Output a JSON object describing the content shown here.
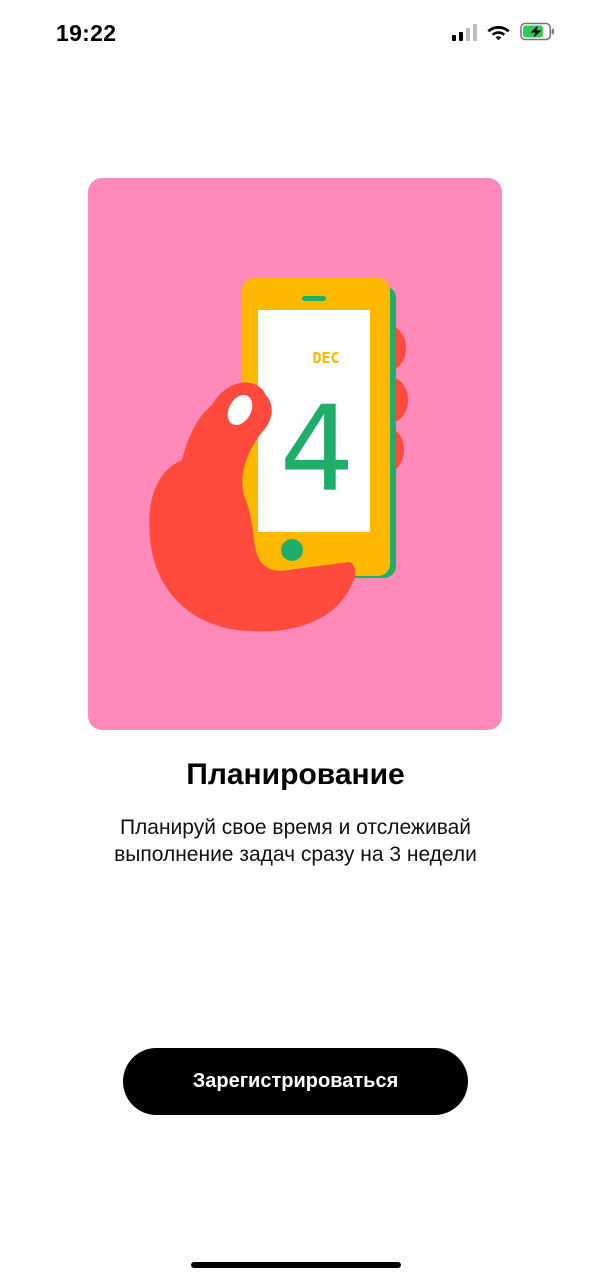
{
  "status_bar": {
    "time": "19:22",
    "icons": [
      "signal-icon",
      "wifi-icon",
      "battery-charging-icon"
    ]
  },
  "illustration": {
    "background_color": "#ff8ab9",
    "month": "DEC",
    "day": "4",
    "colors": {
      "hand": "#ff4a3d",
      "phone": "#ffb800",
      "phone_edge": "#1fae6a",
      "digits": "#1fae6a"
    }
  },
  "onboarding": {
    "title": "Планирование",
    "subtitle": "Планируй свое время и отслеживай выполнение задач сразу на 3 недели"
  },
  "actions": {
    "register_label": "Зарегистрироваться"
  }
}
